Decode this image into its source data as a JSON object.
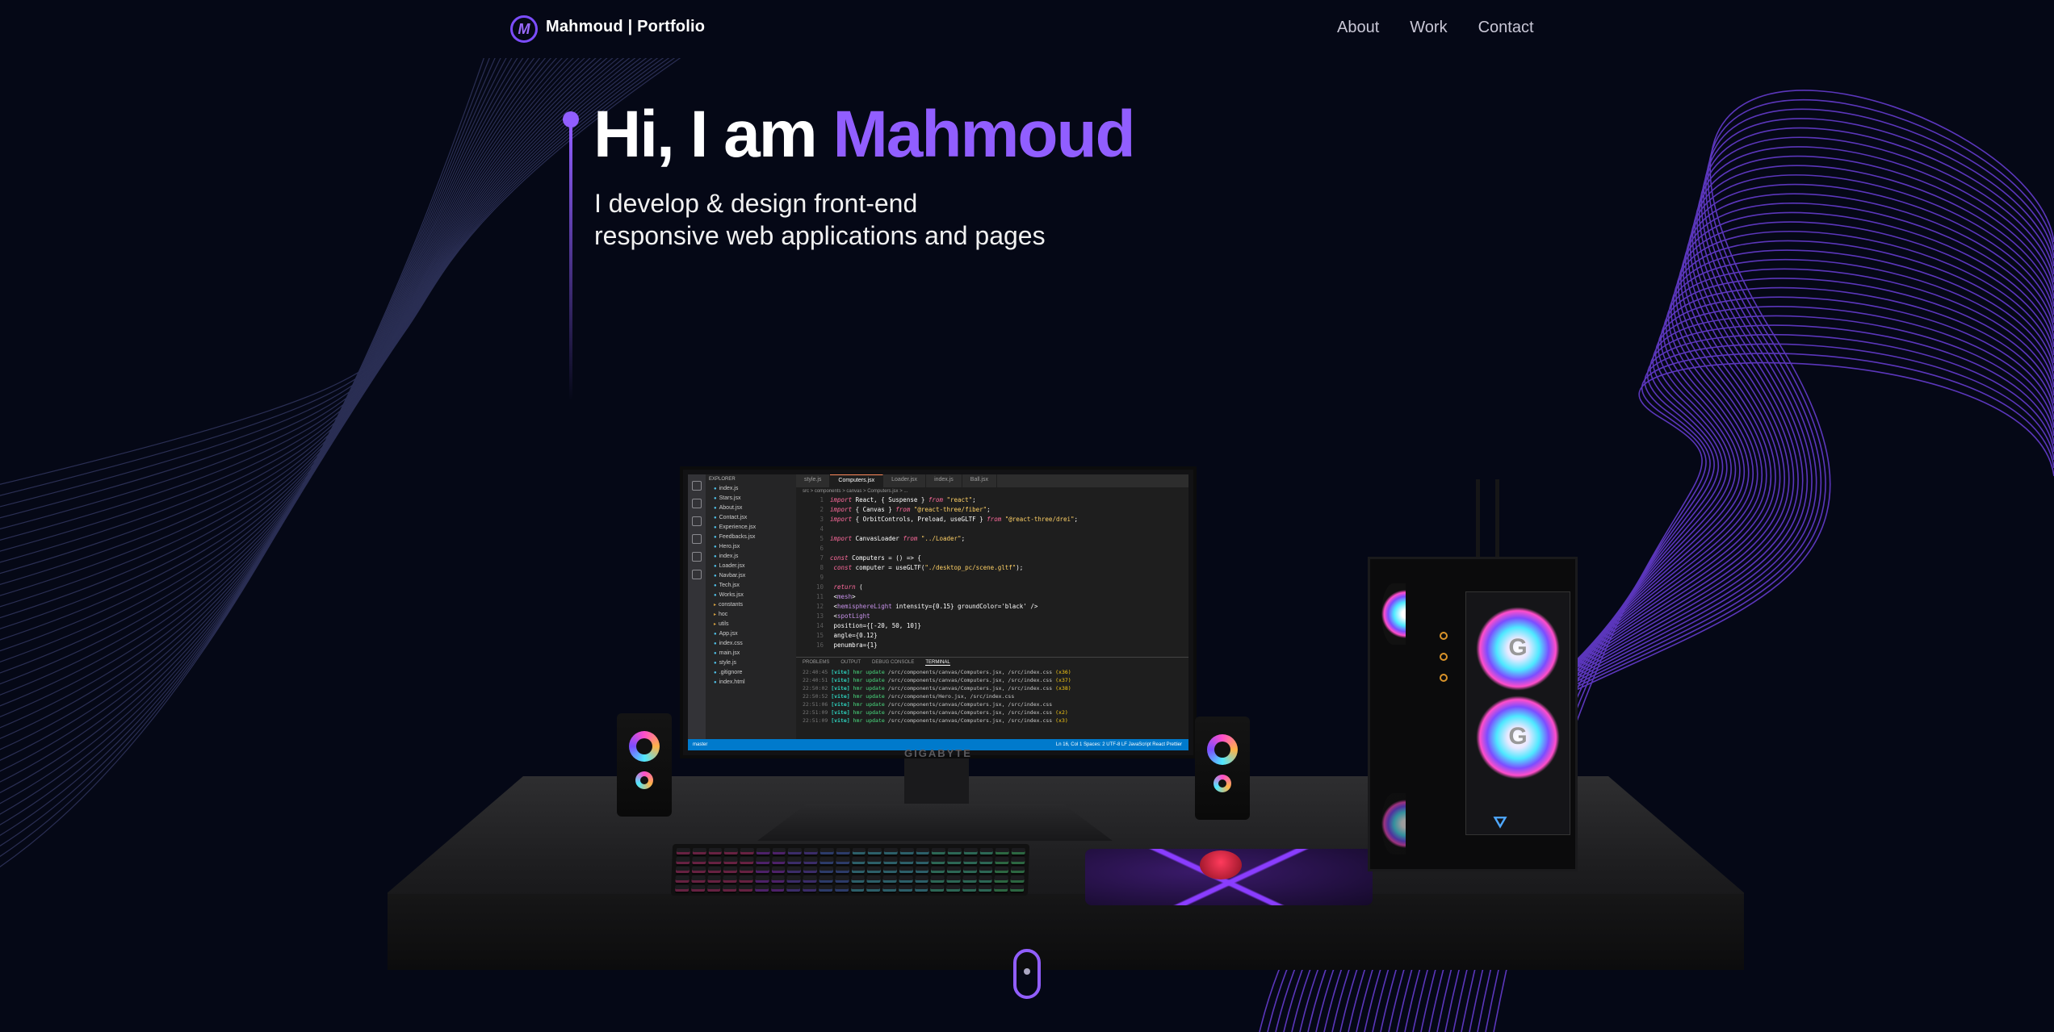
{
  "nav": {
    "logo_letter": "M",
    "brand": "Mahmoud | Portfolio",
    "links": [
      "About",
      "Work",
      "Contact"
    ]
  },
  "hero": {
    "greeting": "Hi, I am ",
    "name": "Mahmoud",
    "subtitle_line1": "I develop & design front-end",
    "subtitle_line2": "responsive web applications and pages"
  },
  "colors": {
    "background": "#050816",
    "accent": "#915eff",
    "text": "#ffffff",
    "secondary": "#c9c7d6"
  },
  "scene": {
    "monitor_brand": "GIGABYTE",
    "editor": {
      "tabs": [
        "style.js",
        "Computers.jsx",
        "Loader.jsx",
        "index.js",
        "Ball.jsx"
      ],
      "active_tab": "Computers.jsx",
      "breadcrumb": "src > components > canvas > Computers.jsx > ...",
      "explorer_title": "EXPLORER",
      "files": [
        "index.js",
        "Stars.jsx",
        "About.jsx",
        "Contact.jsx",
        "Experience.jsx",
        "Feedbacks.jsx",
        "Hero.jsx",
        "index.js",
        "Loader.jsx",
        "Navbar.jsx",
        "Tech.jsx",
        "Works.jsx"
      ],
      "folders": [
        "constants",
        "hoc",
        "utils"
      ],
      "root_files": [
        "App.jsx",
        "index.css",
        "main.jsx",
        "style.js",
        ".gitignore",
        "index.html"
      ],
      "code_lines": [
        "import React, { Suspense } from \"react\";",
        "import { Canvas } from \"@react-three/fiber\";",
        "import { OrbitControls, Preload, useGLTF } from \"@react-three/drei\";",
        "",
        "import CanvasLoader from \"../Loader\";",
        "",
        "const Computers = () => {",
        "  const computer = useGLTF(\"./desktop_pc/scene.gltf\");",
        "",
        "  return (",
        "    <mesh>",
        "      <hemisphereLight intensity={0.15} groundColor='black' />",
        "      <spotLight",
        "        position={[-20, 50, 10]}",
        "        angle={0.12}",
        "        penumbra={1}"
      ],
      "terminal_tabs": [
        "PROBLEMS",
        "OUTPUT",
        "DEBUG CONSOLE",
        "TERMINAL"
      ],
      "terminal_lines": [
        "22:40:45 [vite] hmr update /src/components/canvas/Computers.jsx, /src/index.css (x36)",
        "22:40:51 [vite] hmr update /src/components/canvas/Computers.jsx, /src/index.css (x37)",
        "22:50:02 [vite] hmr update /src/components/canvas/Computers.jsx, /src/index.css (x38)",
        "22:50:52 [vite] hmr update /src/components/Hero.jsx, /src/index.css",
        "22:51:06 [vite] hmr update /src/components/canvas/Computers.jsx, /src/index.css",
        "22:51:09 [vite] hmr update /src/components/canvas/Computers.jsx, /src/index.css (x2)",
        "22:51:09 [vite] hmr update /src/components/canvas/Computers.jsx, /src/index.css (x3)"
      ],
      "status_left": "master",
      "status_right": "Ln 16, Col 1   Spaces: 2   UTF-8   LF   JavaScript React   Prettier"
    }
  }
}
